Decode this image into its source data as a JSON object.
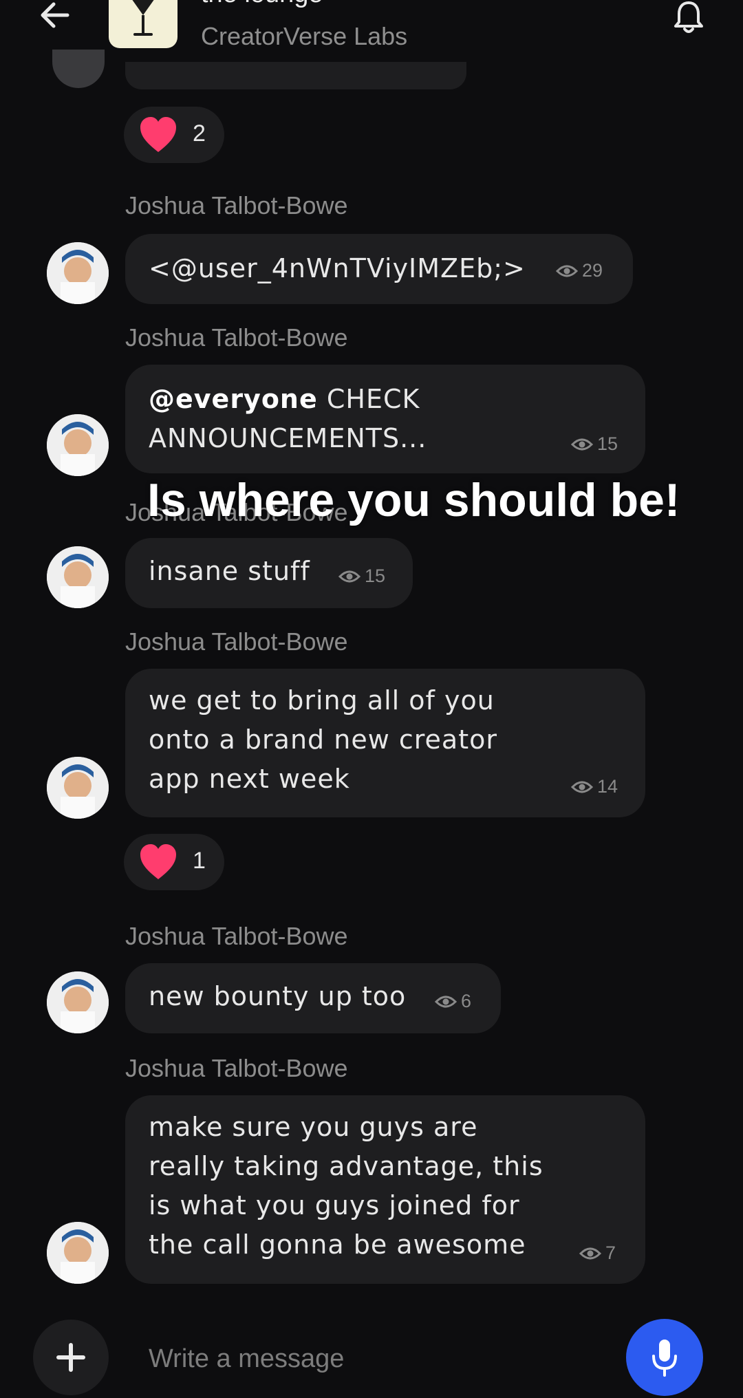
{
  "header": {
    "channel_name": "the lounge",
    "channel_subtitle": "CreatorVerse Labs",
    "back_icon": "arrow-left-icon",
    "bell_icon": "bell-icon"
  },
  "messages": [
    {
      "author": "Joshua Talbot-Bowe",
      "text": "<@user_4nWnTViyIMZEb;>",
      "views": "29"
    },
    {
      "author": "Joshua Talbot-Bowe",
      "mention": "@everyone",
      "text_line1": " CHECK",
      "text_line2": "ANNOUNCEMENTS...",
      "views": "15"
    },
    {
      "author": "Joshua Talbot-Bowe",
      "text": "insane stuff",
      "views": "15"
    },
    {
      "author": "Joshua Talbot-Bowe",
      "lines": [
        "we get to bring all of you",
        "onto a brand new creator",
        "app next week"
      ],
      "views": "14"
    },
    {
      "author": "Joshua Talbot-Bowe",
      "text": "new bounty up too",
      "views": "6"
    },
    {
      "author": "Joshua Talbot-Bowe",
      "lines": [
        "make sure you guys are",
        "really taking advantage, this",
        "is what you guys joined for",
        "the call gonna be awesome"
      ],
      "views": "7"
    }
  ],
  "reactions": [
    {
      "emoji": "heart",
      "count": "2"
    },
    {
      "emoji": "heart",
      "count": "1"
    }
  ],
  "overlay_caption": "Is where you should be!",
  "composer": {
    "placeholder": "Write a message",
    "add_icon": "plus-icon",
    "mic_icon": "microphone-icon"
  },
  "colors": {
    "background": "#0d0d0f",
    "bubble": "#1e1e20",
    "accent": "#2c5bf0",
    "heart": "#ff3d6e"
  }
}
